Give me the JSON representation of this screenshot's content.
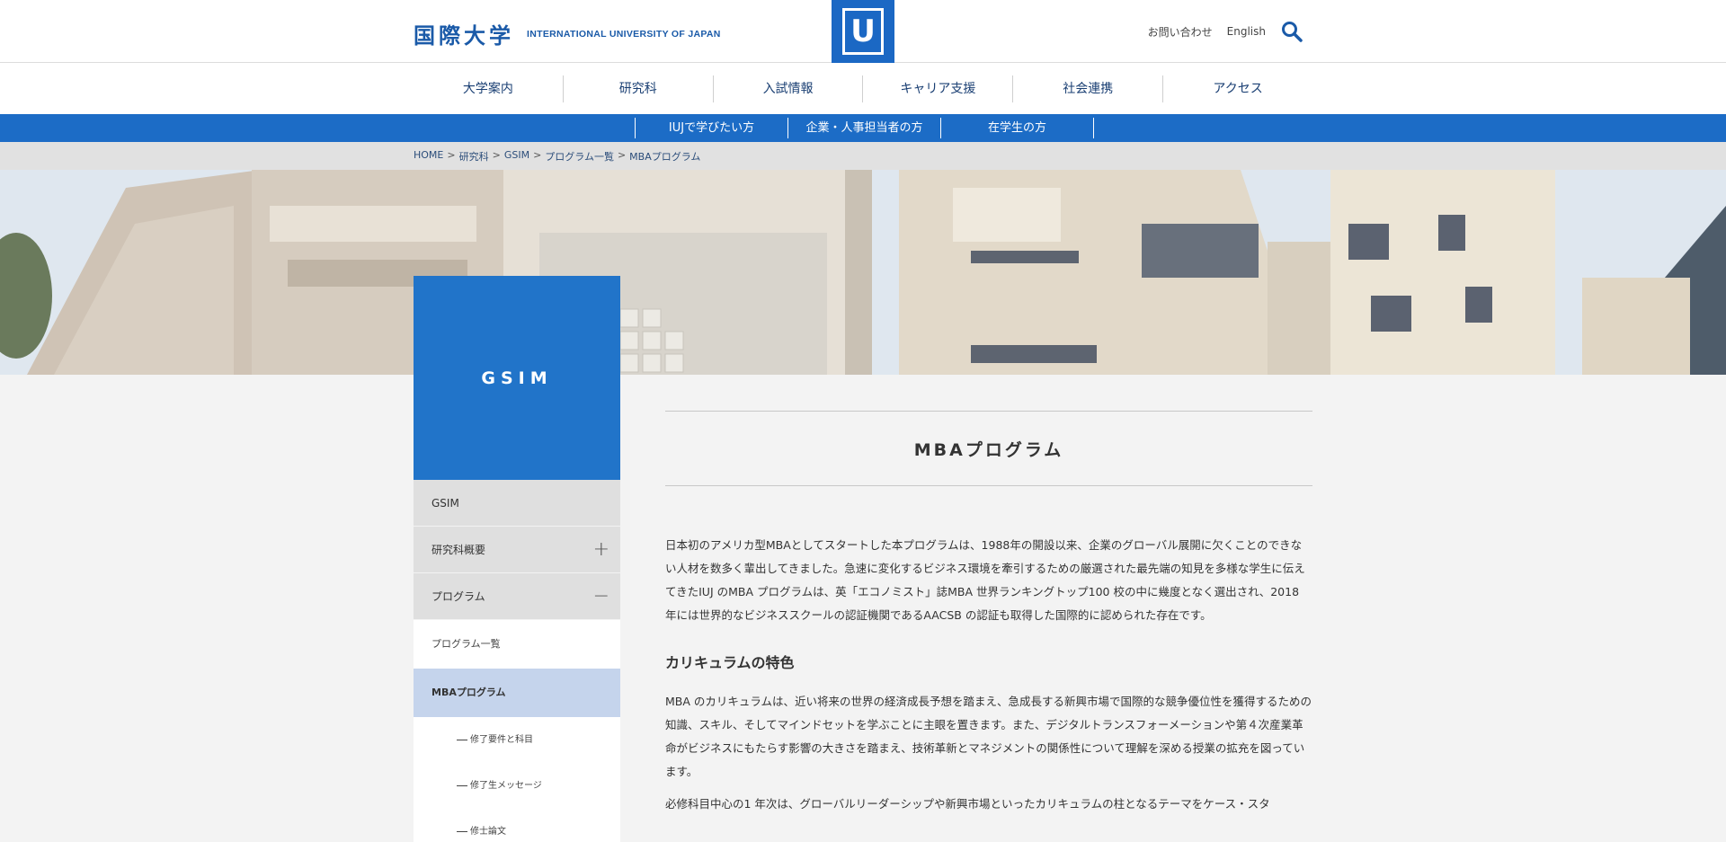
{
  "header": {
    "logo_jp": "国際大学",
    "logo_en": "INTERNATIONAL UNIVERSITY OF JAPAN",
    "emblem": "U",
    "contact": "お問い合わせ",
    "english": "English",
    "search_icon": "search-icon"
  },
  "global_nav": [
    "大学案内",
    "研究科",
    "入試情報",
    "キャリア支援",
    "社会連携",
    "アクセス"
  ],
  "sub_nav": [
    "IUJで学びたい方",
    "企業・人事担当者の方",
    "在学生の方"
  ],
  "breadcrumb": [
    "HOME",
    "研究科",
    "GSIM",
    "プログラム一覧",
    "MBAプログラム"
  ],
  "sidebar": {
    "title": "GSIM",
    "items": [
      {
        "label": "GSIM",
        "toggle": ""
      },
      {
        "label": "研究科概要",
        "toggle": "+"
      },
      {
        "label": "プログラム",
        "toggle": "−"
      }
    ],
    "sub_items": [
      "プログラム一覧",
      "MBAプログラム"
    ],
    "subsub_items": [
      "修了要件と科目",
      "修了生メッセージ",
      "修士論文"
    ]
  },
  "main": {
    "title": "MBAプログラム",
    "intro": "日本初のアメリカ型MBAとしてスタートした本プログラムは、1988年の開設以来、企業のグローバル展開に欠くことのできない人材を数多く輩出してきました。急速に変化するビジネス環境を牽引するための厳選された最先端の知見を多様な学生に伝えてきたIUJ のMBA プログラムは、英「エコノミスト」誌MBA 世界ランキングトップ100 校の中に幾度となく選出され、2018 年には世界的なビジネススクールの認証機関であるAACSB の認証も取得した国際的に認められた存在です。",
    "heading": "カリキュラムの特色",
    "para2": "MBA のカリキュラムは、近い将来の世界の経済成長予想を踏まえ、急成長する新興市場で国際的な競争優位性を獲得するための知識、スキル、そしてマインドセットを学ぶことに主眼を置きます。また、デジタルトランスフォーメーションや第４次産業革命がビジネスにもたらす影響の大きさを踏まえ、技術革新とマネジメントの関係性について理解を深める授業の拡充を図っています。",
    "para3": "必修科目中心の1 年次は、グローバルリーダーシップや新興市場といったカリキュラムの柱となるテーマをケース・スタ"
  },
  "colors": {
    "brand_blue": "#1b68c4",
    "subnav_blue": "#1c6cc6",
    "active_item": "#c5d4ec"
  }
}
